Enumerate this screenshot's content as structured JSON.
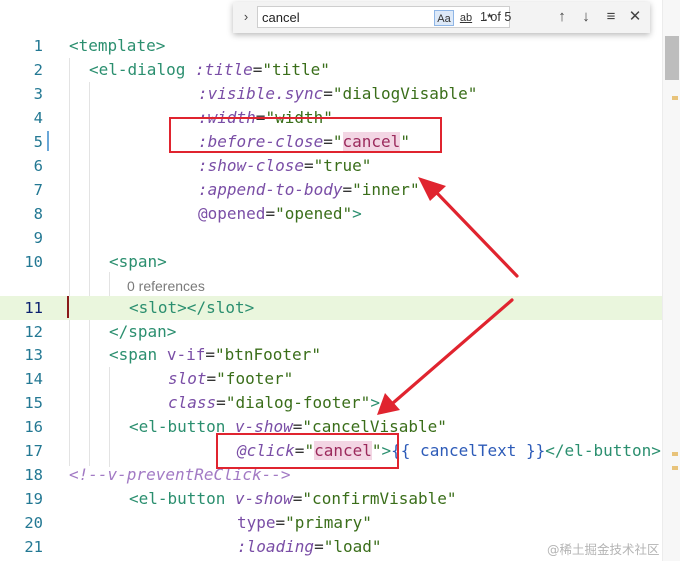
{
  "find_widget": {
    "query": "cancel",
    "match_case_label": "Aa",
    "whole_word_label": "ab",
    "regex_label": ".*",
    "result_count": "1 of 5"
  },
  "code_lens": {
    "text": "0 references"
  },
  "lines": [
    {
      "n": "1"
    },
    {
      "n": "2"
    },
    {
      "n": "3"
    },
    {
      "n": "4"
    },
    {
      "n": "5"
    },
    {
      "n": "6"
    },
    {
      "n": "7"
    },
    {
      "n": "8"
    },
    {
      "n": "9"
    },
    {
      "n": "10"
    },
    {
      "n": "11"
    },
    {
      "n": "12"
    },
    {
      "n": "13"
    },
    {
      "n": "14"
    },
    {
      "n": "15"
    },
    {
      "n": "16"
    },
    {
      "n": "17"
    },
    {
      "n": "18"
    },
    {
      "n": "19"
    },
    {
      "n": "20"
    },
    {
      "n": "21"
    }
  ],
  "tokens": {
    "l1": {
      "open": "<",
      "name": "template",
      "close": ">"
    },
    "l2": {
      "open": "<",
      "name": "el-dialog",
      "attr": ":title",
      "eq": "=",
      "val": "\"title\""
    },
    "l3": {
      "attr": ":visible.sync",
      "eq": "=",
      "val": "\"dialogVisable\""
    },
    "l4": {
      "attr": ":width",
      "eq": "=",
      "val": "\"width\""
    },
    "l5": {
      "attr": ":before-close",
      "eq": "=",
      "q1": "\"",
      "val": "cancel",
      "q2": "\""
    },
    "l6": {
      "attr": ":show-close",
      "eq": "=",
      "val": "\"true\""
    },
    "l7": {
      "attr": ":append-to-body",
      "eq": "=",
      "val": "\"inner\""
    },
    "l8": {
      "attr": "@opened",
      "eq": "=",
      "val": "\"opened\"",
      "close": ">"
    },
    "l10": {
      "open": "<",
      "name": "span",
      "close": ">"
    },
    "l11": {
      "open": "<",
      "name": "slot",
      "mid": "></",
      "name2": "slot",
      "close": ">"
    },
    "l12": {
      "open": "</",
      "name": "span",
      "close": ">"
    },
    "l13": {
      "open": "<",
      "name": "span",
      "attr": "v-if",
      "eq": "=",
      "val": "\"btnFooter\""
    },
    "l14": {
      "attr": "slot",
      "eq": "=",
      "val": "\"footer\""
    },
    "l15": {
      "attr": "class",
      "eq": "=",
      "val": "\"dialog-footer\"",
      "close": ">"
    },
    "l16": {
      "open": "<",
      "name": "el-button",
      "attr": "v-show",
      "eq": "=",
      "val": "\"cancelVisable\""
    },
    "l17": {
      "attr": "@click",
      "eq": "=",
      "q1": "\"",
      "val": "cancel",
      "q2": "\"",
      "close": ">",
      "mustache": "{{ cancelText }}",
      "endopen": "</",
      "endname": "el-button",
      "endclose": ">"
    },
    "l18": {
      "comment": "<!--v-preventReClick-->"
    },
    "l19": {
      "open": "<",
      "name": "el-button",
      "attr": "v-show",
      "eq": "=",
      "val": "\"confirmVisable\""
    },
    "l20": {
      "attr": "type",
      "eq": "=",
      "val": "\"primary\""
    },
    "l21": {
      "attr": ":loading",
      "eq": "=",
      "val": "\"load\""
    }
  },
  "watermark": "@稀土掘金技术社区"
}
